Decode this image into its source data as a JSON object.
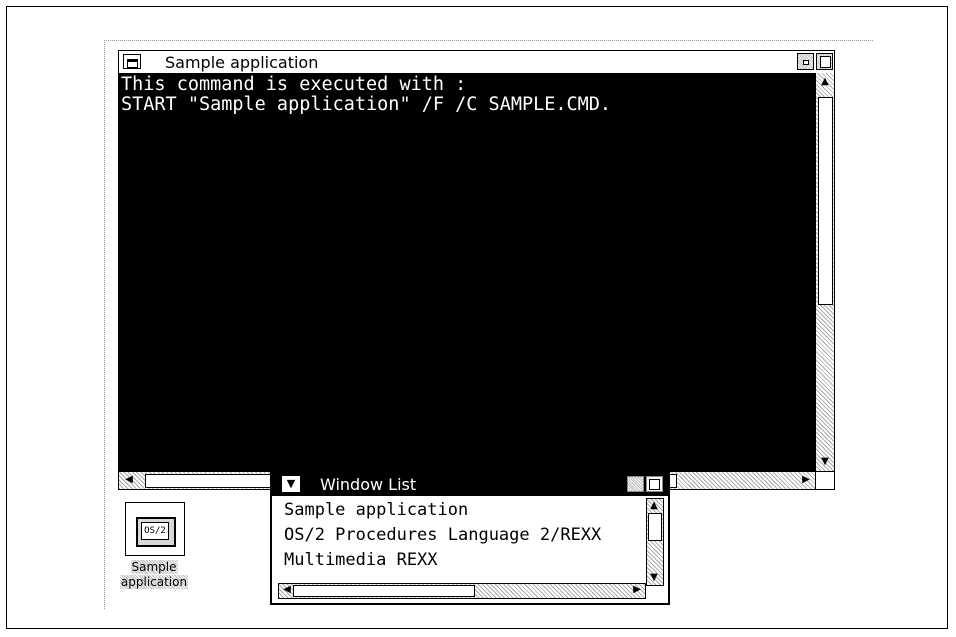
{
  "main_window": {
    "title": "Sample application",
    "console_lines": [
      "This command is executed with :",
      "START \"Sample application\" /F /C SAMPLE.CMD."
    ]
  },
  "window_list": {
    "title": "Window List",
    "items": [
      "Sample application",
      "OS/2 Procedures Language 2/REXX",
      "Multimedia REXX"
    ]
  },
  "desktop_icon": {
    "badge": "OS/2",
    "label_line1": "Sample",
    "label_line2": "application"
  }
}
